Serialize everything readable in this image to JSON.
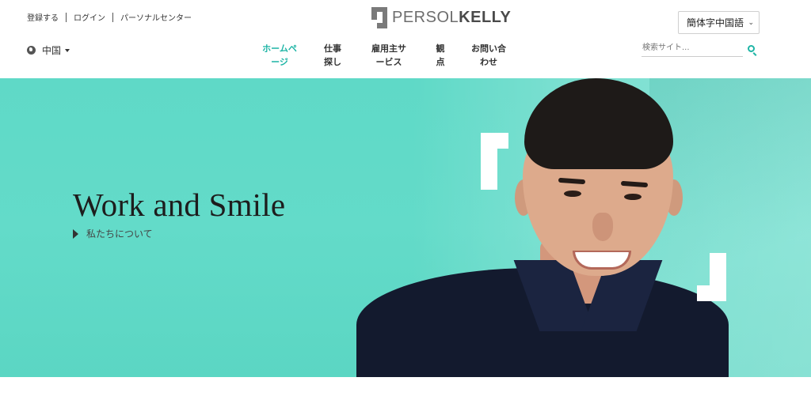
{
  "header": {
    "util_links": [
      "登録する",
      "ログイン",
      "パーソナルセンター"
    ],
    "logo": {
      "light": "PERSOL",
      "bold": "KELLY"
    },
    "language": {
      "selected": "簡体字中国語"
    },
    "region": {
      "label": "中国"
    },
    "nav": [
      {
        "line1": "ホームペ",
        "line2": "ージ",
        "active": true
      },
      {
        "line1": "仕事",
        "line2": "探し",
        "active": false
      },
      {
        "line1": "雇用主サ",
        "line2": "ービス",
        "active": false
      },
      {
        "line1": "観",
        "line2": "点",
        "active": false
      },
      {
        "line1": "お問い合",
        "line2": "わせ",
        "active": false
      }
    ],
    "search": {
      "placeholder": "検索サイト..."
    }
  },
  "hero": {
    "title": "Work and Smile",
    "link": "私たちについて"
  },
  "colors": {
    "accent": "#1fb5a6",
    "hero_bg": "#5fd9c7"
  }
}
